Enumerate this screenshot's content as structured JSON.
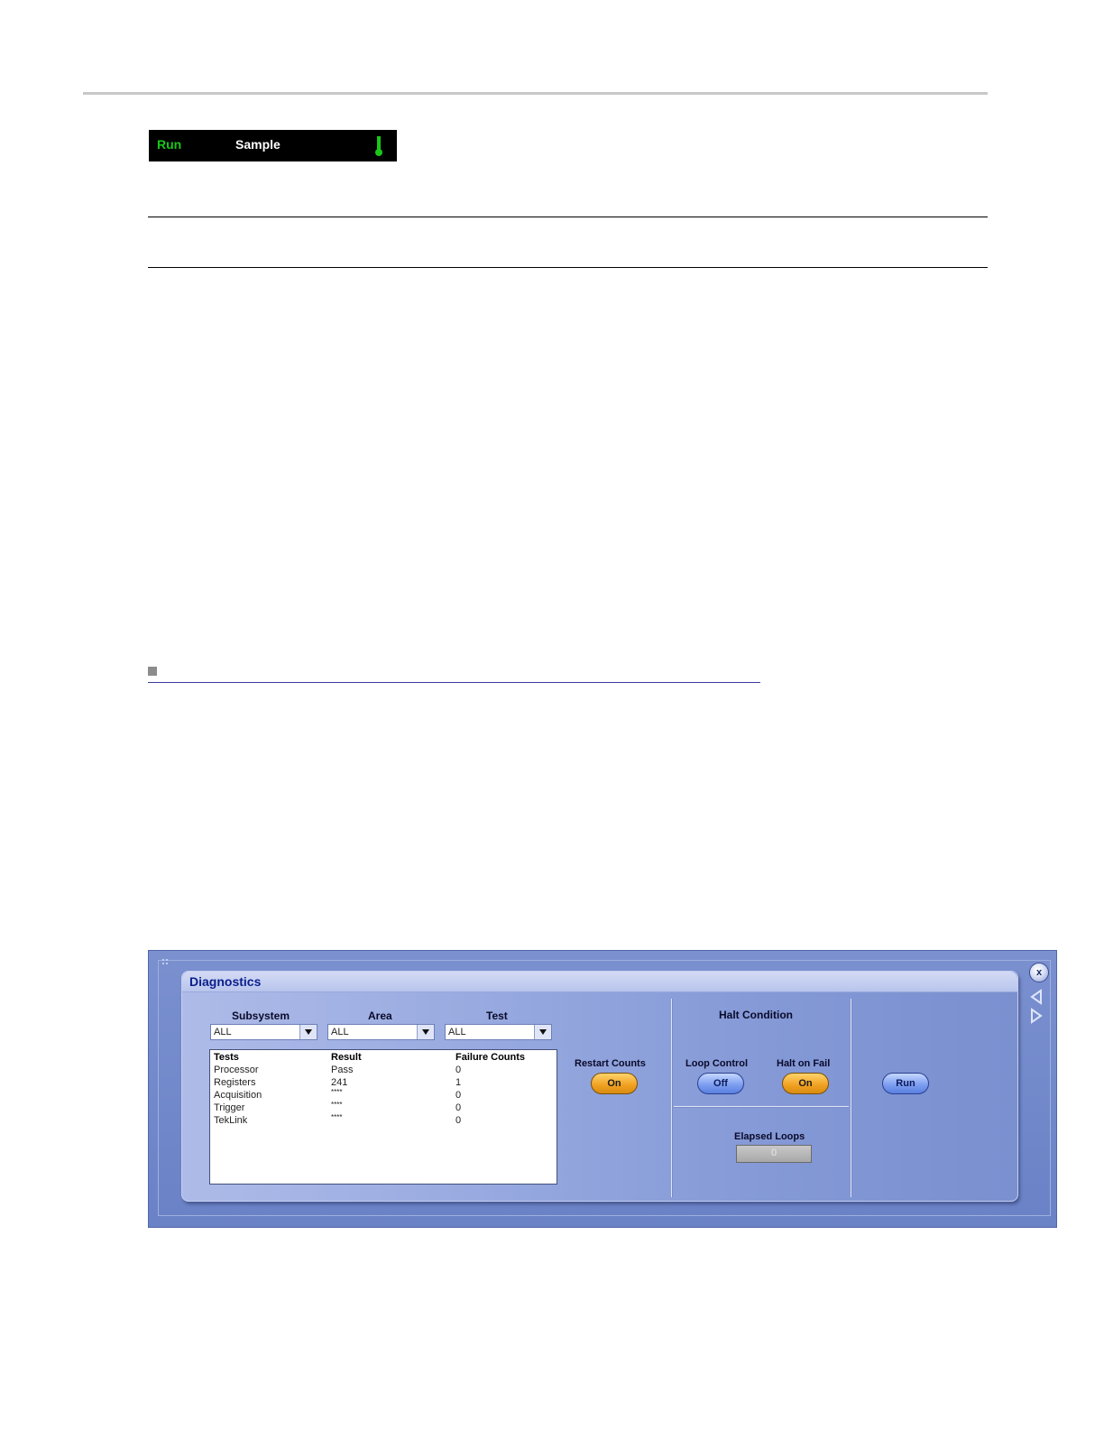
{
  "status_bar": {
    "run_label": "Run",
    "mode_label": "Sample",
    "icon": "thermometer-icon"
  },
  "diagnostics": {
    "title": "Diagnostics",
    "filters": [
      {
        "label": "Subsystem",
        "value": "ALL"
      },
      {
        "label": "Area",
        "value": "ALL"
      },
      {
        "label": "Test",
        "value": "ALL"
      }
    ],
    "results": {
      "headers": [
        "Tests",
        "Result",
        "Failure Counts"
      ],
      "rows": [
        {
          "test": "Processor",
          "result": "Pass",
          "failures": "0"
        },
        {
          "test": "Registers",
          "result": "241",
          "failures": "1"
        },
        {
          "test": "Acquisition",
          "result": "****",
          "failures": "0"
        },
        {
          "test": "Trigger",
          "result": "****",
          "failures": "0"
        },
        {
          "test": "TekLink",
          "result": "****",
          "failures": "0"
        }
      ]
    },
    "restart_counts": {
      "label": "Restart Counts",
      "button": "On"
    },
    "halt_condition": {
      "title": "Halt Condition",
      "loop_control": {
        "label": "Loop Control",
        "button": "Off"
      },
      "halt_on_fail": {
        "label": "Halt on Fail",
        "button": "On"
      }
    },
    "elapsed_loops": {
      "label": "Elapsed Loops",
      "value": "0"
    },
    "run_button": "Run",
    "close_button": "x",
    "colors": {
      "title": "#0a1e8c",
      "on_button": "#f0a020",
      "off_button": "#7e9ff0",
      "status_run": "#19c819"
    }
  }
}
